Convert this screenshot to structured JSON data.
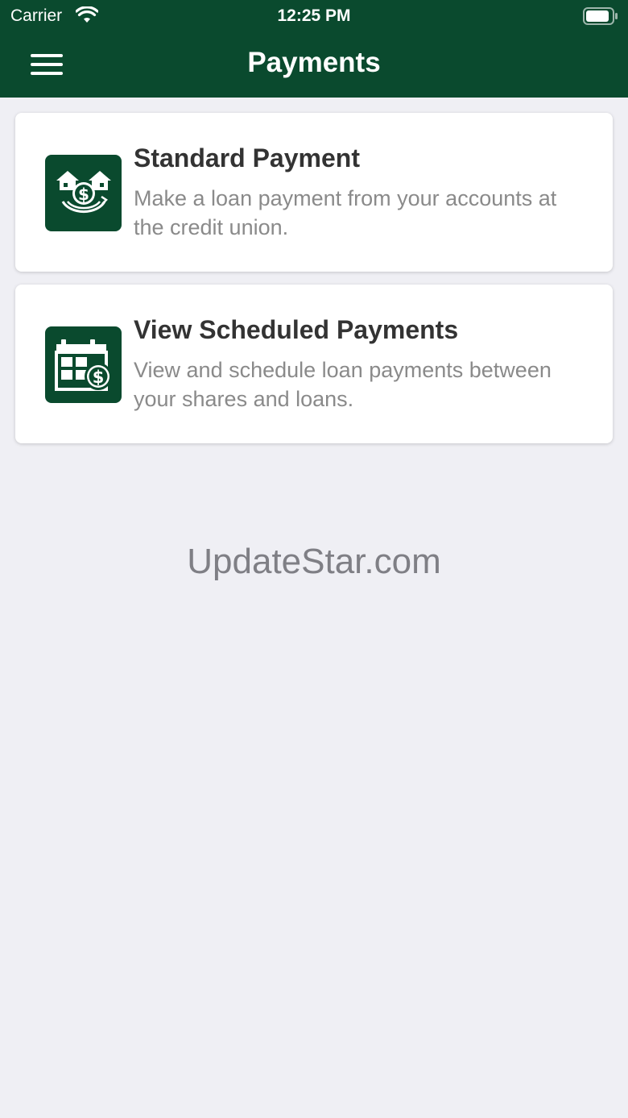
{
  "status_bar": {
    "carrier": "Carrier",
    "time": "12:25 PM"
  },
  "header": {
    "title": "Payments",
    "background_color": "#0a4a2e"
  },
  "icons": {
    "menu": "hamburger-menu-icon",
    "wifi": "wifi-icon",
    "battery": "battery-icon",
    "standard_payment": "house-dollar-icon",
    "scheduled_payments": "calendar-dollar-icon"
  },
  "cards": [
    {
      "title": "Standard Payment",
      "description": "Make a loan payment from your accounts at the credit union."
    },
    {
      "title": "View Scheduled Payments",
      "description": "View and schedule loan payments between your shares and loans."
    }
  ],
  "watermark": "UpdateStar.com"
}
